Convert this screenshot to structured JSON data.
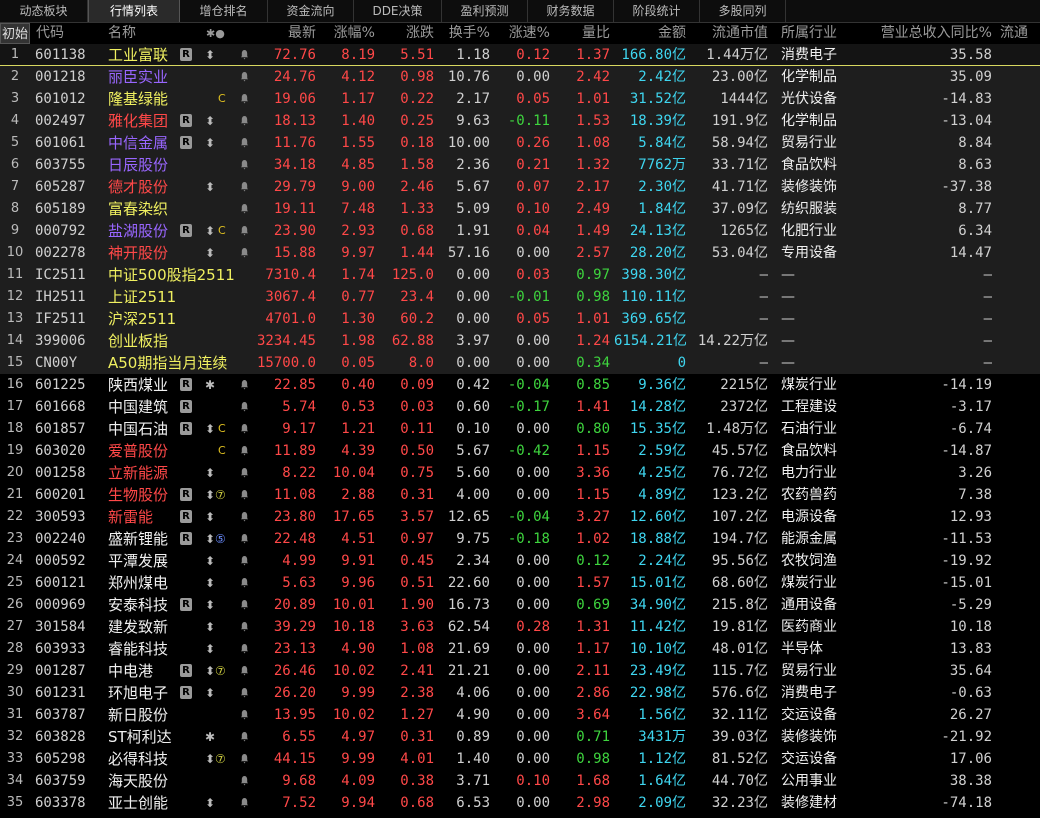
{
  "tabs": [
    "动态板块",
    "行情列表",
    "增仓排名",
    "资金流向",
    "DDE决策",
    "盈利预测",
    "财务数据",
    "阶段统计",
    "多股同列"
  ],
  "active_tab": 1,
  "init_button": "初始",
  "headers": {
    "code": "代码",
    "name": "名称",
    "mark": "✱●",
    "price": "最新",
    "chg_pct": "涨幅%",
    "chg": "涨跌",
    "turnover": "换手%",
    "speed": "涨速%",
    "vol_ratio": "量比",
    "amount": "金额",
    "float_cap": "流通市值",
    "industry": "所属行业",
    "rev_yoy": "营业总收入同比%",
    "extra": "流通"
  },
  "colors": {
    "up": "#ff4848",
    "down": "#3ed43e",
    "flat": "#d0d0d0",
    "amount": "#3fd6f0",
    "code": "#d0d0d0",
    "name_default": "#f0f0f0",
    "name_red": "#ff4848",
    "name_purple": "#9966ff",
    "name_yellow": "#f0f060",
    "num": "#d0d0d0"
  },
  "rows": [
    {
      "n": "1",
      "code": "601138",
      "name": "工业富联",
      "name_color": "yellow",
      "r": true,
      "arrow": true,
      "tag": "",
      "bell": true,
      "price": "72.76",
      "chg_pct": "8.19",
      "chg": "5.51",
      "turnover": "1.18",
      "speed": "0.12",
      "vol_ratio": "1.37",
      "amount": "166.80亿",
      "float_cap": "1.44万亿",
      "industry": "消费电子",
      "rev": "35.58",
      "dir": "up",
      "sdir": "up",
      "vdir": "up",
      "shade": true,
      "sel": true
    },
    {
      "n": "2",
      "code": "001218",
      "name": "丽臣实业",
      "name_color": "purple",
      "r": false,
      "arrow": false,
      "tag": "",
      "bell": true,
      "price": "24.76",
      "chg_pct": "4.12",
      "chg": "0.98",
      "turnover": "10.76",
      "speed": "0.00",
      "vol_ratio": "2.42",
      "amount": "2.42亿",
      "float_cap": "23.00亿",
      "industry": "化学制品",
      "rev": "35.09",
      "dir": "up",
      "sdir": "flat",
      "vdir": "up",
      "shade": true
    },
    {
      "n": "3",
      "code": "601012",
      "name": "隆基绿能",
      "name_color": "yellow",
      "r": false,
      "arrow": false,
      "tag": "C",
      "bell": true,
      "price": "19.06",
      "chg_pct": "1.17",
      "chg": "0.22",
      "turnover": "2.17",
      "speed": "0.05",
      "vol_ratio": "1.01",
      "amount": "31.52亿",
      "float_cap": "1444亿",
      "industry": "光伏设备",
      "rev": "-14.83",
      "dir": "up",
      "sdir": "up",
      "vdir": "up",
      "shade": true
    },
    {
      "n": "4",
      "code": "002497",
      "name": "雅化集团",
      "name_color": "red",
      "r": true,
      "arrow": true,
      "tag": "",
      "bell": true,
      "price": "18.13",
      "chg_pct": "1.40",
      "chg": "0.25",
      "turnover": "9.63",
      "speed": "-0.11",
      "vol_ratio": "1.53",
      "amount": "18.39亿",
      "float_cap": "191.9亿",
      "industry": "化学制品",
      "rev": "-13.04",
      "dir": "up",
      "sdir": "down",
      "vdir": "up",
      "shade": true
    },
    {
      "n": "5",
      "code": "601061",
      "name": "中信金属",
      "name_color": "purple",
      "r": true,
      "arrow": true,
      "tag": "",
      "bell": true,
      "price": "11.76",
      "chg_pct": "1.55",
      "chg": "0.18",
      "turnover": "10.00",
      "speed": "0.26",
      "vol_ratio": "1.08",
      "amount": "5.84亿",
      "float_cap": "58.94亿",
      "industry": "贸易行业",
      "rev": "8.84",
      "dir": "up",
      "sdir": "up",
      "vdir": "up",
      "shade": true
    },
    {
      "n": "6",
      "code": "603755",
      "name": "日辰股份",
      "name_color": "purple",
      "r": false,
      "arrow": false,
      "tag": "",
      "bell": true,
      "price": "34.18",
      "chg_pct": "4.85",
      "chg": "1.58",
      "turnover": "2.36",
      "speed": "0.21",
      "vol_ratio": "1.32",
      "amount": "7762万",
      "float_cap": "33.71亿",
      "industry": "食品饮料",
      "rev": "8.63",
      "dir": "up",
      "sdir": "up",
      "vdir": "up",
      "shade": true
    },
    {
      "n": "7",
      "code": "605287",
      "name": "德才股份",
      "name_color": "red",
      "r": false,
      "arrow": true,
      "tag": "",
      "bell": true,
      "price": "29.79",
      "chg_pct": "9.00",
      "chg": "2.46",
      "turnover": "5.67",
      "speed": "0.07",
      "vol_ratio": "2.17",
      "amount": "2.30亿",
      "float_cap": "41.71亿",
      "industry": "装修装饰",
      "rev": "-37.38",
      "dir": "up",
      "sdir": "up",
      "vdir": "up",
      "shade": true
    },
    {
      "n": "8",
      "code": "605189",
      "name": "富春染织",
      "name_color": "yellow",
      "r": false,
      "arrow": false,
      "tag": "",
      "bell": true,
      "price": "19.11",
      "chg_pct": "7.48",
      "chg": "1.33",
      "turnover": "5.09",
      "speed": "0.10",
      "vol_ratio": "2.49",
      "amount": "1.84亿",
      "float_cap": "37.09亿",
      "industry": "纺织服装",
      "rev": "8.77",
      "dir": "up",
      "sdir": "up",
      "vdir": "up",
      "shade": true
    },
    {
      "n": "9",
      "code": "000792",
      "name": "盐湖股份",
      "name_color": "purple",
      "r": true,
      "arrow": true,
      "tag": "C",
      "bell": true,
      "price": "23.90",
      "chg_pct": "2.93",
      "chg": "0.68",
      "turnover": "1.91",
      "speed": "0.04",
      "vol_ratio": "1.49",
      "amount": "24.13亿",
      "float_cap": "1265亿",
      "industry": "化肥行业",
      "rev": "6.34",
      "dir": "up",
      "sdir": "up",
      "vdir": "up",
      "shade": true
    },
    {
      "n": "10",
      "code": "002278",
      "name": "神开股份",
      "name_color": "red",
      "r": false,
      "arrow": true,
      "tag": "",
      "bell": true,
      "price": "15.88",
      "chg_pct": "9.97",
      "chg": "1.44",
      "turnover": "57.16",
      "speed": "0.00",
      "vol_ratio": "2.57",
      "amount": "28.20亿",
      "float_cap": "53.04亿",
      "industry": "专用设备",
      "rev": "14.47",
      "dir": "up",
      "sdir": "flat",
      "vdir": "up",
      "shade": true
    },
    {
      "n": "11",
      "code": "IC2511",
      "name": "中证500股指2511",
      "name_color": "yellow",
      "r": false,
      "arrow": false,
      "tag": "",
      "bell": false,
      "price": "7310.4",
      "chg_pct": "1.74",
      "chg": "125.0",
      "turnover": "0.00",
      "speed": "0.03",
      "vol_ratio": "0.97",
      "amount": "398.30亿",
      "float_cap": "—",
      "industry": "—",
      "rev": "—",
      "dir": "up",
      "sdir": "up",
      "vdir": "down",
      "shade": true
    },
    {
      "n": "12",
      "code": "IH2511",
      "name": "上证2511",
      "name_color": "yellow",
      "r": false,
      "arrow": false,
      "tag": "",
      "bell": false,
      "price": "3067.4",
      "chg_pct": "0.77",
      "chg": "23.4",
      "turnover": "0.00",
      "speed": "-0.01",
      "vol_ratio": "0.98",
      "amount": "110.11亿",
      "float_cap": "—",
      "industry": "—",
      "rev": "—",
      "dir": "up",
      "sdir": "down",
      "vdir": "down",
      "shade": true
    },
    {
      "n": "13",
      "code": "IF2511",
      "name": "沪深2511",
      "name_color": "yellow",
      "r": false,
      "arrow": false,
      "tag": "",
      "bell": false,
      "price": "4701.0",
      "chg_pct": "1.30",
      "chg": "60.2",
      "turnover": "0.00",
      "speed": "0.05",
      "vol_ratio": "1.01",
      "amount": "369.65亿",
      "float_cap": "—",
      "industry": "—",
      "rev": "—",
      "dir": "up",
      "sdir": "up",
      "vdir": "up",
      "shade": true
    },
    {
      "n": "14",
      "code": "399006",
      "name": "创业板指",
      "name_color": "yellow",
      "r": false,
      "arrow": false,
      "tag": "",
      "bell": false,
      "price": "3234.45",
      "chg_pct": "1.98",
      "chg": "62.88",
      "turnover": "3.97",
      "speed": "0.00",
      "vol_ratio": "1.24",
      "amount": "6154.21亿",
      "float_cap": "14.22万亿",
      "industry": "—",
      "rev": "—",
      "dir": "up",
      "sdir": "flat",
      "vdir": "up",
      "shade": true
    },
    {
      "n": "15",
      "code": "CN00Y",
      "name": "A50期指当月连续",
      "name_color": "yellow",
      "r": false,
      "arrow": false,
      "tag": "",
      "bell": false,
      "price": "15700.0",
      "chg_pct": "0.05",
      "chg": "8.0",
      "turnover": "0.00",
      "speed": "0.00",
      "vol_ratio": "0.34",
      "amount": "0",
      "float_cap": "—",
      "industry": "—",
      "rev": "—",
      "dir": "up",
      "sdir": "flat",
      "vdir": "down",
      "shade": true
    },
    {
      "n": "16",
      "code": "601225",
      "name": "陕西煤业",
      "name_color": "default",
      "r": true,
      "arrow": false,
      "tag": "✱",
      "bell": true,
      "price": "22.85",
      "chg_pct": "0.40",
      "chg": "0.09",
      "turnover": "0.42",
      "speed": "-0.04",
      "vol_ratio": "0.85",
      "amount": "9.36亿",
      "float_cap": "2215亿",
      "industry": "煤炭行业",
      "rev": "-14.19",
      "dir": "up",
      "sdir": "down",
      "vdir": "down"
    },
    {
      "n": "17",
      "code": "601668",
      "name": "中国建筑",
      "name_color": "default",
      "r": true,
      "arrow": false,
      "tag": "",
      "bell": true,
      "price": "5.74",
      "chg_pct": "0.53",
      "chg": "0.03",
      "turnover": "0.60",
      "speed": "-0.17",
      "vol_ratio": "1.41",
      "amount": "14.28亿",
      "float_cap": "2372亿",
      "industry": "工程建设",
      "rev": "-3.17",
      "dir": "up",
      "sdir": "down",
      "vdir": "up"
    },
    {
      "n": "18",
      "code": "601857",
      "name": "中国石油",
      "name_color": "default",
      "r": true,
      "arrow": true,
      "tag": "C",
      "bell": true,
      "price": "9.17",
      "chg_pct": "1.21",
      "chg": "0.11",
      "turnover": "0.10",
      "speed": "0.00",
      "vol_ratio": "0.80",
      "amount": "15.35亿",
      "float_cap": "1.48万亿",
      "industry": "石油行业",
      "rev": "-6.74",
      "dir": "up",
      "sdir": "flat",
      "vdir": "down"
    },
    {
      "n": "19",
      "code": "603020",
      "name": "爱普股份",
      "name_color": "red",
      "r": false,
      "arrow": false,
      "tag": "C",
      "bell": true,
      "price": "11.89",
      "chg_pct": "4.39",
      "chg": "0.50",
      "turnover": "5.67",
      "speed": "-0.42",
      "vol_ratio": "1.15",
      "amount": "2.59亿",
      "float_cap": "45.57亿",
      "industry": "食品饮料",
      "rev": "-14.87",
      "dir": "up",
      "sdir": "down",
      "vdir": "up"
    },
    {
      "n": "20",
      "code": "001258",
      "name": "立新能源",
      "name_color": "red",
      "r": false,
      "arrow": true,
      "tag": "",
      "bell": true,
      "price": "8.22",
      "chg_pct": "10.04",
      "chg": "0.75",
      "turnover": "5.60",
      "speed": "0.00",
      "vol_ratio": "3.36",
      "amount": "4.25亿",
      "float_cap": "76.72亿",
      "industry": "电力行业",
      "rev": "3.26",
      "dir": "up",
      "sdir": "flat",
      "vdir": "up"
    },
    {
      "n": "21",
      "code": "600201",
      "name": "生物股份",
      "name_color": "red",
      "r": true,
      "arrow": true,
      "tag": "⑦",
      "bell": true,
      "price": "11.08",
      "chg_pct": "2.88",
      "chg": "0.31",
      "turnover": "4.00",
      "speed": "0.00",
      "vol_ratio": "1.15",
      "amount": "4.89亿",
      "float_cap": "123.2亿",
      "industry": "农药兽药",
      "rev": "7.38",
      "dir": "up",
      "sdir": "flat",
      "vdir": "up"
    },
    {
      "n": "22",
      "code": "300593",
      "name": "新雷能",
      "name_color": "red",
      "r": true,
      "arrow": true,
      "tag": "",
      "bell": true,
      "price": "23.80",
      "chg_pct": "17.65",
      "chg": "3.57",
      "turnover": "12.65",
      "speed": "-0.04",
      "vol_ratio": "3.27",
      "amount": "12.60亿",
      "float_cap": "107.2亿",
      "industry": "电源设备",
      "rev": "12.93",
      "dir": "up",
      "sdir": "down",
      "vdir": "up"
    },
    {
      "n": "23",
      "code": "002240",
      "name": "盛新锂能",
      "name_color": "default",
      "r": true,
      "arrow": true,
      "tag": "⑤",
      "bell": true,
      "price": "22.48",
      "chg_pct": "4.51",
      "chg": "0.97",
      "turnover": "9.75",
      "speed": "-0.18",
      "vol_ratio": "1.02",
      "amount": "18.88亿",
      "float_cap": "194.7亿",
      "industry": "能源金属",
      "rev": "-11.53",
      "dir": "up",
      "sdir": "down",
      "vdir": "up"
    },
    {
      "n": "24",
      "code": "000592",
      "name": "平潭发展",
      "name_color": "default",
      "r": false,
      "arrow": true,
      "tag": "",
      "bell": true,
      "price": "4.99",
      "chg_pct": "9.91",
      "chg": "0.45",
      "turnover": "2.34",
      "speed": "0.00",
      "vol_ratio": "0.12",
      "amount": "2.24亿",
      "float_cap": "95.56亿",
      "industry": "农牧饲渔",
      "rev": "-19.92",
      "dir": "up",
      "sdir": "flat",
      "vdir": "down"
    },
    {
      "n": "25",
      "code": "600121",
      "name": "郑州煤电",
      "name_color": "default",
      "r": false,
      "arrow": true,
      "tag": "",
      "bell": true,
      "price": "5.63",
      "chg_pct": "9.96",
      "chg": "0.51",
      "turnover": "22.60",
      "speed": "0.00",
      "vol_ratio": "1.57",
      "amount": "15.01亿",
      "float_cap": "68.60亿",
      "industry": "煤炭行业",
      "rev": "-15.01",
      "dir": "up",
      "sdir": "flat",
      "vdir": "up"
    },
    {
      "n": "26",
      "code": "000969",
      "name": "安泰科技",
      "name_color": "default",
      "r": true,
      "arrow": true,
      "tag": "",
      "bell": true,
      "price": "20.89",
      "chg_pct": "10.01",
      "chg": "1.90",
      "turnover": "16.73",
      "speed": "0.00",
      "vol_ratio": "0.69",
      "amount": "34.90亿",
      "float_cap": "215.8亿",
      "industry": "通用设备",
      "rev": "-5.29",
      "dir": "up",
      "sdir": "flat",
      "vdir": "down"
    },
    {
      "n": "27",
      "code": "301584",
      "name": "建发致新",
      "name_color": "default",
      "r": false,
      "arrow": true,
      "tag": "",
      "bell": true,
      "price": "39.29",
      "chg_pct": "10.18",
      "chg": "3.63",
      "turnover": "62.54",
      "speed": "0.28",
      "vol_ratio": "1.31",
      "amount": "11.42亿",
      "float_cap": "19.81亿",
      "industry": "医药商业",
      "rev": "10.18",
      "dir": "up",
      "sdir": "up",
      "vdir": "up"
    },
    {
      "n": "28",
      "code": "603933",
      "name": "睿能科技",
      "name_color": "default",
      "r": false,
      "arrow": true,
      "tag": "",
      "bell": true,
      "price": "23.13",
      "chg_pct": "4.90",
      "chg": "1.08",
      "turnover": "21.69",
      "speed": "0.00",
      "vol_ratio": "1.17",
      "amount": "10.10亿",
      "float_cap": "48.01亿",
      "industry": "半导体",
      "rev": "13.83",
      "dir": "up",
      "sdir": "flat",
      "vdir": "up"
    },
    {
      "n": "29",
      "code": "001287",
      "name": "中电港",
      "name_color": "default",
      "r": true,
      "arrow": true,
      "tag": "⑦",
      "bell": true,
      "price": "26.46",
      "chg_pct": "10.02",
      "chg": "2.41",
      "turnover": "21.21",
      "speed": "0.00",
      "vol_ratio": "2.11",
      "amount": "23.49亿",
      "float_cap": "115.7亿",
      "industry": "贸易行业",
      "rev": "35.64",
      "dir": "up",
      "sdir": "flat",
      "vdir": "up"
    },
    {
      "n": "30",
      "code": "601231",
      "name": "环旭电子",
      "name_color": "default",
      "r": true,
      "arrow": true,
      "tag": "",
      "bell": true,
      "price": "26.20",
      "chg_pct": "9.99",
      "chg": "2.38",
      "turnover": "4.06",
      "speed": "0.00",
      "vol_ratio": "2.86",
      "amount": "22.98亿",
      "float_cap": "576.6亿",
      "industry": "消费电子",
      "rev": "-0.63",
      "dir": "up",
      "sdir": "flat",
      "vdir": "up"
    },
    {
      "n": "31",
      "code": "603787",
      "name": "新日股份",
      "name_color": "default",
      "r": false,
      "arrow": false,
      "tag": "",
      "bell": true,
      "price": "13.95",
      "chg_pct": "10.02",
      "chg": "1.27",
      "turnover": "4.90",
      "speed": "0.00",
      "vol_ratio": "3.64",
      "amount": "1.56亿",
      "float_cap": "32.11亿",
      "industry": "交运设备",
      "rev": "26.27",
      "dir": "up",
      "sdir": "flat",
      "vdir": "up"
    },
    {
      "n": "32",
      "code": "603828",
      "name": "ST柯利达",
      "name_color": "default",
      "r": false,
      "arrow": false,
      "tag": "✱",
      "bell": true,
      "price": "6.55",
      "chg_pct": "4.97",
      "chg": "0.31",
      "turnover": "0.89",
      "speed": "0.00",
      "vol_ratio": "0.71",
      "amount": "3431万",
      "float_cap": "39.03亿",
      "industry": "装修装饰",
      "rev": "-21.92",
      "dir": "up",
      "sdir": "flat",
      "vdir": "down"
    },
    {
      "n": "33",
      "code": "605298",
      "name": "必得科技",
      "name_color": "default",
      "r": false,
      "arrow": true,
      "tag": "⑦",
      "bell": true,
      "price": "44.15",
      "chg_pct": "9.99",
      "chg": "4.01",
      "turnover": "1.40",
      "speed": "0.00",
      "vol_ratio": "0.98",
      "amount": "1.12亿",
      "float_cap": "81.52亿",
      "industry": "交运设备",
      "rev": "17.06",
      "dir": "up",
      "sdir": "flat",
      "vdir": "down"
    },
    {
      "n": "34",
      "code": "603759",
      "name": "海天股份",
      "name_color": "default",
      "r": false,
      "arrow": false,
      "tag": "",
      "bell": true,
      "price": "9.68",
      "chg_pct": "4.09",
      "chg": "0.38",
      "turnover": "3.71",
      "speed": "0.10",
      "vol_ratio": "1.68",
      "amount": "1.64亿",
      "float_cap": "44.70亿",
      "industry": "公用事业",
      "rev": "38.38",
      "dir": "up",
      "sdir": "up",
      "vdir": "up"
    },
    {
      "n": "35",
      "code": "603378",
      "name": "亚士创能",
      "name_color": "default",
      "r": false,
      "arrow": true,
      "tag": "",
      "bell": true,
      "price": "7.52",
      "chg_pct": "9.94",
      "chg": "0.68",
      "turnover": "6.53",
      "speed": "0.00",
      "vol_ratio": "2.98",
      "amount": "2.09亿",
      "float_cap": "32.23亿",
      "industry": "装修建材",
      "rev": "-74.18",
      "dir": "up",
      "sdir": "flat",
      "vdir": "up"
    }
  ]
}
